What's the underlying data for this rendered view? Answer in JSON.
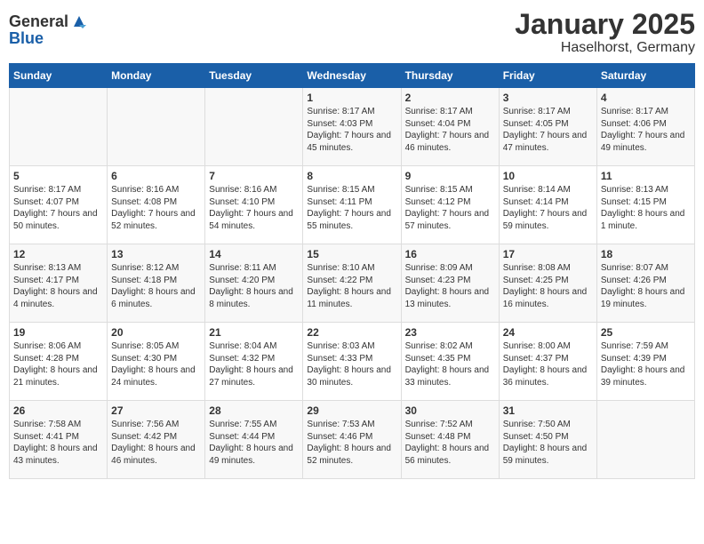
{
  "header": {
    "logo_general": "General",
    "logo_blue": "Blue",
    "title": "January 2025",
    "subtitle": "Haselhorst, Germany"
  },
  "weekdays": [
    "Sunday",
    "Monday",
    "Tuesday",
    "Wednesday",
    "Thursday",
    "Friday",
    "Saturday"
  ],
  "weeks": [
    [
      {
        "day": "",
        "text": ""
      },
      {
        "day": "",
        "text": ""
      },
      {
        "day": "",
        "text": ""
      },
      {
        "day": "1",
        "text": "Sunrise: 8:17 AM\nSunset: 4:03 PM\nDaylight: 7 hours and 45 minutes."
      },
      {
        "day": "2",
        "text": "Sunrise: 8:17 AM\nSunset: 4:04 PM\nDaylight: 7 hours and 46 minutes."
      },
      {
        "day": "3",
        "text": "Sunrise: 8:17 AM\nSunset: 4:05 PM\nDaylight: 7 hours and 47 minutes."
      },
      {
        "day": "4",
        "text": "Sunrise: 8:17 AM\nSunset: 4:06 PM\nDaylight: 7 hours and 49 minutes."
      }
    ],
    [
      {
        "day": "5",
        "text": "Sunrise: 8:17 AM\nSunset: 4:07 PM\nDaylight: 7 hours and 50 minutes."
      },
      {
        "day": "6",
        "text": "Sunrise: 8:16 AM\nSunset: 4:08 PM\nDaylight: 7 hours and 52 minutes."
      },
      {
        "day": "7",
        "text": "Sunrise: 8:16 AM\nSunset: 4:10 PM\nDaylight: 7 hours and 54 minutes."
      },
      {
        "day": "8",
        "text": "Sunrise: 8:15 AM\nSunset: 4:11 PM\nDaylight: 7 hours and 55 minutes."
      },
      {
        "day": "9",
        "text": "Sunrise: 8:15 AM\nSunset: 4:12 PM\nDaylight: 7 hours and 57 minutes."
      },
      {
        "day": "10",
        "text": "Sunrise: 8:14 AM\nSunset: 4:14 PM\nDaylight: 7 hours and 59 minutes."
      },
      {
        "day": "11",
        "text": "Sunrise: 8:13 AM\nSunset: 4:15 PM\nDaylight: 8 hours and 1 minute."
      }
    ],
    [
      {
        "day": "12",
        "text": "Sunrise: 8:13 AM\nSunset: 4:17 PM\nDaylight: 8 hours and 4 minutes."
      },
      {
        "day": "13",
        "text": "Sunrise: 8:12 AM\nSunset: 4:18 PM\nDaylight: 8 hours and 6 minutes."
      },
      {
        "day": "14",
        "text": "Sunrise: 8:11 AM\nSunset: 4:20 PM\nDaylight: 8 hours and 8 minutes."
      },
      {
        "day": "15",
        "text": "Sunrise: 8:10 AM\nSunset: 4:22 PM\nDaylight: 8 hours and 11 minutes."
      },
      {
        "day": "16",
        "text": "Sunrise: 8:09 AM\nSunset: 4:23 PM\nDaylight: 8 hours and 13 minutes."
      },
      {
        "day": "17",
        "text": "Sunrise: 8:08 AM\nSunset: 4:25 PM\nDaylight: 8 hours and 16 minutes."
      },
      {
        "day": "18",
        "text": "Sunrise: 8:07 AM\nSunset: 4:26 PM\nDaylight: 8 hours and 19 minutes."
      }
    ],
    [
      {
        "day": "19",
        "text": "Sunrise: 8:06 AM\nSunset: 4:28 PM\nDaylight: 8 hours and 21 minutes."
      },
      {
        "day": "20",
        "text": "Sunrise: 8:05 AM\nSunset: 4:30 PM\nDaylight: 8 hours and 24 minutes."
      },
      {
        "day": "21",
        "text": "Sunrise: 8:04 AM\nSunset: 4:32 PM\nDaylight: 8 hours and 27 minutes."
      },
      {
        "day": "22",
        "text": "Sunrise: 8:03 AM\nSunset: 4:33 PM\nDaylight: 8 hours and 30 minutes."
      },
      {
        "day": "23",
        "text": "Sunrise: 8:02 AM\nSunset: 4:35 PM\nDaylight: 8 hours and 33 minutes."
      },
      {
        "day": "24",
        "text": "Sunrise: 8:00 AM\nSunset: 4:37 PM\nDaylight: 8 hours and 36 minutes."
      },
      {
        "day": "25",
        "text": "Sunrise: 7:59 AM\nSunset: 4:39 PM\nDaylight: 8 hours and 39 minutes."
      }
    ],
    [
      {
        "day": "26",
        "text": "Sunrise: 7:58 AM\nSunset: 4:41 PM\nDaylight: 8 hours and 43 minutes."
      },
      {
        "day": "27",
        "text": "Sunrise: 7:56 AM\nSunset: 4:42 PM\nDaylight: 8 hours and 46 minutes."
      },
      {
        "day": "28",
        "text": "Sunrise: 7:55 AM\nSunset: 4:44 PM\nDaylight: 8 hours and 49 minutes."
      },
      {
        "day": "29",
        "text": "Sunrise: 7:53 AM\nSunset: 4:46 PM\nDaylight: 8 hours and 52 minutes."
      },
      {
        "day": "30",
        "text": "Sunrise: 7:52 AM\nSunset: 4:48 PM\nDaylight: 8 hours and 56 minutes."
      },
      {
        "day": "31",
        "text": "Sunrise: 7:50 AM\nSunset: 4:50 PM\nDaylight: 8 hours and 59 minutes."
      },
      {
        "day": "",
        "text": ""
      }
    ]
  ]
}
